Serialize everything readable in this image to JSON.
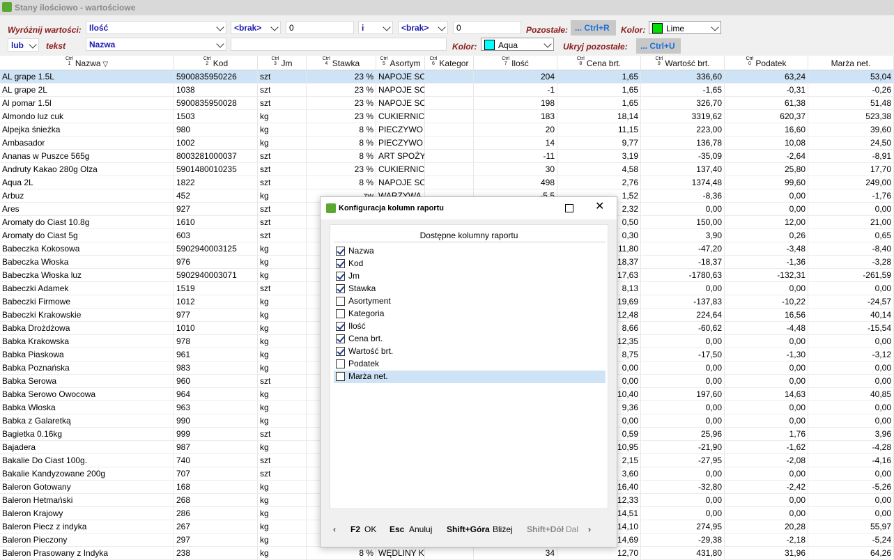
{
  "window": {
    "title": "Stany ilościowo - wartościowe"
  },
  "filters": {
    "highlight_label": "Wyróżnij wartości:",
    "highlight_field": "Ilość",
    "op1": "<brak>",
    "val1": "0",
    "conj": "i",
    "op2": "<brak>",
    "val2": "0",
    "remaining_label": "Pozostałe:",
    "ctrl_r_btn": "... Ctrl+R",
    "color_label": "Kolor:",
    "color1": "Lime",
    "color1_hex": "#00e000",
    "or_value": "lub",
    "text_label": "tekst",
    "text_field": "Nazwa",
    "text_value": "",
    "color2_label": "Kolor:",
    "color2": "Aqua",
    "color2_hex": "#00ffff",
    "hide_label": "Ukryj pozostałe:",
    "ctrl_u_btn": "... Ctrl+U"
  },
  "columns": [
    {
      "label": "Nazwa",
      "ctrl": "Ctrl",
      "key": "1"
    },
    {
      "label": "Kod",
      "ctrl": "Ctrl",
      "key": "2"
    },
    {
      "label": "Jm",
      "ctrl": "Ctrl",
      "key": "3"
    },
    {
      "label": "Stawka",
      "ctrl": "Ctrl",
      "key": "4"
    },
    {
      "label": "Asortym",
      "ctrl": "Ctrl",
      "key": "5"
    },
    {
      "label": "Kategor",
      "ctrl": "Ctrl",
      "key": "6"
    },
    {
      "label": "Ilość",
      "ctrl": "Ctrl",
      "key": "7"
    },
    {
      "label": "Cena brt.",
      "ctrl": "Ctrl",
      "key": "8"
    },
    {
      "label": "Wartość brt.",
      "ctrl": "Ctrl",
      "key": "9"
    },
    {
      "label": "Podatek",
      "ctrl": "Ctrl",
      "key": "0"
    },
    {
      "label": "Marża net.",
      "ctrl": "",
      "key": ""
    }
  ],
  "rows": [
    [
      "AL grape 1.5L",
      "5900835950226",
      "szt",
      "23 %",
      "NAPOJE SO",
      "",
      "204",
      "1,65",
      "336,60",
      "63,24",
      "53,04"
    ],
    [
      "AL grape 2L",
      "1038",
      "szt",
      "23 %",
      "NAPOJE SO",
      "",
      "-1",
      "1,65",
      "-1,65",
      "-0,31",
      "-0,26"
    ],
    [
      "Al pomar 1.5l",
      "5900835950028",
      "szt",
      "23 %",
      "NAPOJE SO",
      "",
      "198",
      "1,65",
      "326,70",
      "61,38",
      "51,48"
    ],
    [
      "Almondo luz cuk",
      "1503",
      "kg",
      "23 %",
      "CUKIERNIC",
      "",
      "183",
      "18,14",
      "3319,62",
      "620,37",
      "523,38"
    ],
    [
      "Alpejka śnieżka",
      "980",
      "kg",
      "8 %",
      "PIECZYWO",
      "",
      "20",
      "11,15",
      "223,00",
      "16,60",
      "39,60"
    ],
    [
      "Ambasador",
      "1002",
      "kg",
      "8 %",
      "PIECZYWO",
      "",
      "14",
      "9,77",
      "136,78",
      "10,08",
      "24,50"
    ],
    [
      "Ananas w Puszce 565g",
      "8003281000037",
      "szt",
      "8 %",
      "ART SPOŻY",
      "",
      "-11",
      "3,19",
      "-35,09",
      "-2,64",
      "-8,91"
    ],
    [
      "Andruty Kakao 280g Olza",
      "5901480010235",
      "szt",
      "23 %",
      "CUKIERNIC",
      "",
      "30",
      "4,58",
      "137,40",
      "25,80",
      "17,70"
    ],
    [
      "Aqua 2L",
      "1822",
      "szt",
      "8 %",
      "NAPOJE SO",
      "",
      "498",
      "2,76",
      "1374,48",
      "99,60",
      "249,00"
    ],
    [
      "Arbuz",
      "452",
      "kg",
      "zw",
      "WARZYWA",
      "",
      "-5,5",
      "1,52",
      "-8,36",
      "0,00",
      "-1,76"
    ],
    [
      "Ares",
      "927",
      "szt",
      "",
      "",
      "",
      "",
      "2,32",
      "0,00",
      "0,00",
      "0,00"
    ],
    [
      "Aromaty do Ciast 10.8g",
      "1610",
      "szt",
      "",
      "",
      "",
      "",
      "0,50",
      "150,00",
      "12,00",
      "21,00"
    ],
    [
      "Aromaty do Ciast 5g",
      "603",
      "szt",
      "",
      "",
      "",
      "",
      "0,30",
      "3,90",
      "0,26",
      "0,65"
    ],
    [
      "Babeczka Kokosowa",
      "5902940003125",
      "kg",
      "",
      "",
      "",
      "",
      "11,80",
      "-47,20",
      "-3,48",
      "-8,40"
    ],
    [
      "Babeczka Włoska",
      "976",
      "kg",
      "",
      "",
      "",
      "",
      "18,37",
      "-18,37",
      "-1,36",
      "-3,28"
    ],
    [
      "Babeczka Włoska luz",
      "5902940003071",
      "kg",
      "",
      "",
      "",
      "",
      "17,63",
      "-1780,63",
      "-132,31",
      "-261,59"
    ],
    [
      "Babeczki Adamek",
      "1519",
      "szt",
      "",
      "",
      "",
      "",
      "8,13",
      "0,00",
      "0,00",
      "0,00"
    ],
    [
      "Babeczki Firmowe",
      "1012",
      "kg",
      "",
      "",
      "",
      "",
      "19,69",
      "-137,83",
      "-10,22",
      "-24,57"
    ],
    [
      "Babeczki Krakowskie",
      "977",
      "kg",
      "",
      "",
      "",
      "",
      "12,48",
      "224,64",
      "16,56",
      "40,14"
    ],
    [
      "Babka Drożdżowa",
      "1010",
      "kg",
      "",
      "",
      "",
      "",
      "8,66",
      "-60,62",
      "-4,48",
      "-15,54"
    ],
    [
      "Babka Krakowska",
      "978",
      "kg",
      "",
      "",
      "",
      "",
      "12,35",
      "0,00",
      "0,00",
      "0,00"
    ],
    [
      "Babka Piaskowa",
      "961",
      "kg",
      "",
      "",
      "",
      "",
      "8,75",
      "-17,50",
      "-1,30",
      "-3,12"
    ],
    [
      "Babka Poznańska",
      "983",
      "kg",
      "",
      "",
      "",
      "",
      "0,00",
      "0,00",
      "0,00",
      "0,00"
    ],
    [
      "Babka Serowa",
      "960",
      "szt",
      "",
      "",
      "",
      "",
      "0,00",
      "0,00",
      "0,00",
      "0,00"
    ],
    [
      "Babka Serowo Owocowa",
      "964",
      "kg",
      "",
      "",
      "",
      "",
      "10,40",
      "197,60",
      "14,63",
      "40,85"
    ],
    [
      "Babka Włoska",
      "963",
      "kg",
      "",
      "",
      "",
      "",
      "9,36",
      "0,00",
      "0,00",
      "0,00"
    ],
    [
      "Babka z Galaretką",
      "990",
      "kg",
      "",
      "",
      "",
      "",
      "0,00",
      "0,00",
      "0,00",
      "0,00"
    ],
    [
      "Bagietka 0.16kg",
      "999",
      "szt",
      "",
      "",
      "",
      "",
      "0,59",
      "25,96",
      "1,76",
      "3,96"
    ],
    [
      "Bajadera",
      "987",
      "kg",
      "",
      "",
      "",
      "",
      "10,95",
      "-21,90",
      "-1,62",
      "-4,28"
    ],
    [
      "Bakalie Do Ciast 100g.",
      "740",
      "szt",
      "",
      "",
      "",
      "",
      "2,15",
      "-27,95",
      "-2,08",
      "-4,16"
    ],
    [
      "Bakalie Kandyzowane 200g",
      "707",
      "szt",
      "",
      "",
      "",
      "",
      "3,60",
      "0,00",
      "0,00",
      "0,00"
    ],
    [
      "Baleron Gotowany",
      "168",
      "kg",
      "",
      "",
      "",
      "",
      "16,40",
      "-32,80",
      "-2,42",
      "-5,26"
    ],
    [
      "Baleron Hetmański",
      "268",
      "kg",
      "",
      "",
      "",
      "",
      "12,33",
      "0,00",
      "0,00",
      "0,00"
    ],
    [
      "Baleron Krajowy",
      "286",
      "kg",
      "",
      "",
      "",
      "",
      "14,51",
      "0,00",
      "0,00",
      "0,00"
    ],
    [
      "Baleron Piecz z indyka",
      "267",
      "kg",
      "",
      "",
      "",
      "",
      "14,10",
      "274,95",
      "20,28",
      "55,97"
    ],
    [
      "Baleron Pieczony",
      "297",
      "kg",
      "",
      "",
      "",
      "",
      "14,69",
      "-29,38",
      "-2,18",
      "-5,24"
    ],
    [
      "Baleron Prasowany z Indyka",
      "238",
      "kg",
      "8 %",
      "WĘDLINY K",
      "",
      "34",
      "12,70",
      "431,80",
      "31,96",
      "64,26"
    ]
  ],
  "dialog": {
    "title": "Konfiguracja kolumn raportu",
    "panel_header": "Dostępne kolumny raportu",
    "items": [
      {
        "label": "Nazwa",
        "checked": true
      },
      {
        "label": "Kod",
        "checked": true
      },
      {
        "label": "Jm",
        "checked": true
      },
      {
        "label": "Stawka",
        "checked": true
      },
      {
        "label": "Asortyment",
        "checked": false
      },
      {
        "label": "Kategoria",
        "checked": false
      },
      {
        "label": "Ilość",
        "checked": true
      },
      {
        "label": "Cena brt.",
        "checked": true
      },
      {
        "label": "Wartość brt.",
        "checked": true
      },
      {
        "label": "Podatek",
        "checked": false
      },
      {
        "label": "Marża net.",
        "checked": false
      }
    ],
    "footer": {
      "f2_key": "F2",
      "f2_label": "OK",
      "esc_key": "Esc",
      "esc_label": "Anuluj",
      "up_key": "Shift+Góra",
      "up_label": "Bliżej",
      "down_key": "Shift+Dół",
      "down_label": "Dal"
    }
  }
}
